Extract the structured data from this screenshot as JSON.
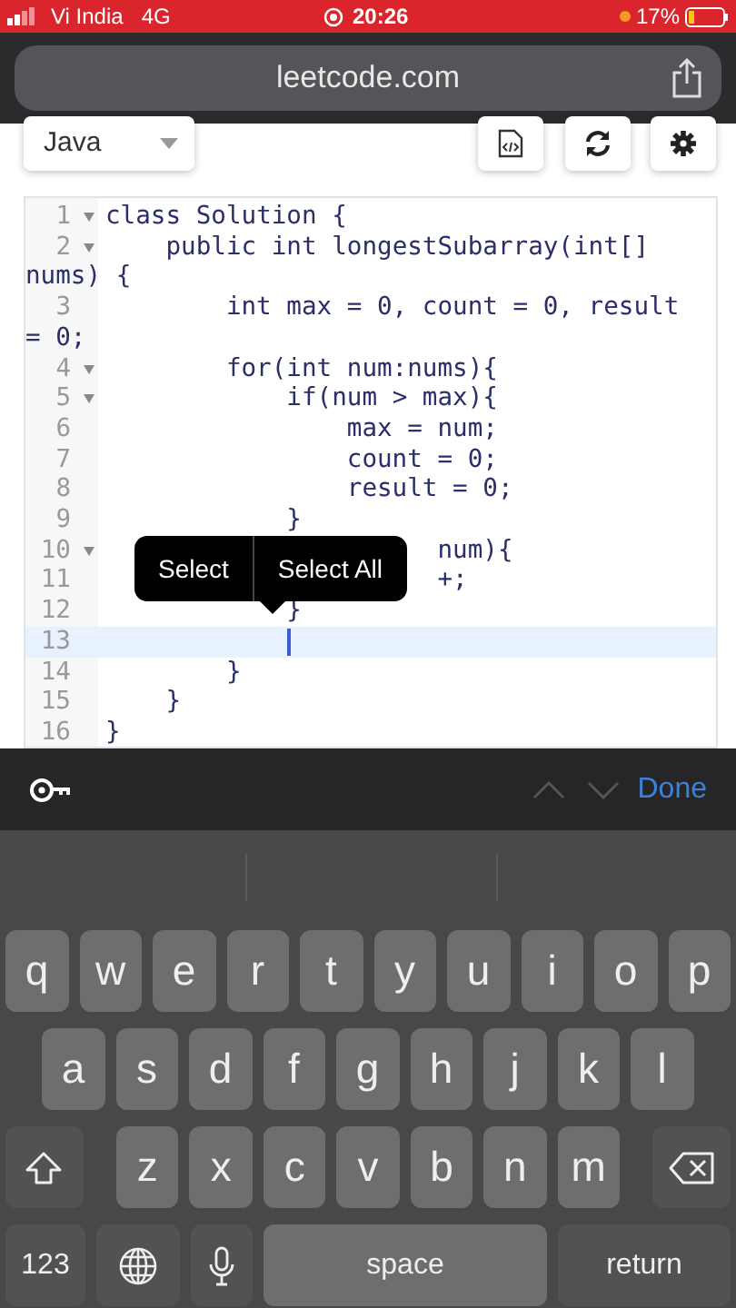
{
  "status_bar": {
    "carrier": "Vi India",
    "network": "4G",
    "time": "20:26",
    "battery": "17%"
  },
  "address_bar": {
    "url": "leetcode.com"
  },
  "toolbar": {
    "language": "Java"
  },
  "editor": {
    "lines": [
      {
        "number": "1",
        "rows": [
          "class Solution {"
        ],
        "foldable": true,
        "active": false
      },
      {
        "number": "2",
        "rows": [
          "    public int longestSubarray(int[]",
          "nums) {"
        ],
        "foldable": true,
        "active": false
      },
      {
        "number": "3",
        "rows": [
          "        int max = 0, count = 0, result",
          "= 0;"
        ],
        "foldable": false,
        "active": false
      },
      {
        "number": "4",
        "rows": [
          "        for(int num:nums){"
        ],
        "foldable": true,
        "active": false
      },
      {
        "number": "5",
        "rows": [
          "            if(num > max){"
        ],
        "foldable": true,
        "active": false
      },
      {
        "number": "6",
        "rows": [
          "                max = num;"
        ],
        "foldable": false,
        "active": false
      },
      {
        "number": "7",
        "rows": [
          "                count = 0;"
        ],
        "foldable": false,
        "active": false
      },
      {
        "number": "8",
        "rows": [
          "                result = 0;"
        ],
        "foldable": false,
        "active": false
      },
      {
        "number": "9",
        "rows": [
          "            }"
        ],
        "foldable": false,
        "active": false
      },
      {
        "number": "10",
        "rows": [
          "                      num){"
        ],
        "foldable": true,
        "active": false
      },
      {
        "number": "11",
        "rows": [
          "                      +;"
        ],
        "foldable": false,
        "active": false
      },
      {
        "number": "12",
        "rows": [
          "            }"
        ],
        "foldable": false,
        "active": false
      },
      {
        "number": "13",
        "rows": [
          "            "
        ],
        "foldable": false,
        "active": true
      },
      {
        "number": "14",
        "rows": [
          "        }"
        ],
        "foldable": false,
        "active": false
      },
      {
        "number": "15",
        "rows": [
          "    }"
        ],
        "foldable": false,
        "active": false
      },
      {
        "number": "16",
        "rows": [
          "}"
        ],
        "foldable": false,
        "active": false
      }
    ],
    "context_menu": {
      "items": [
        "Select",
        "Select All"
      ]
    }
  },
  "keyboard": {
    "accessory": {
      "done": "Done"
    },
    "rows": [
      [
        {
          "kind": "letter",
          "label": "q"
        },
        {
          "kind": "letter",
          "label": "w"
        },
        {
          "kind": "letter",
          "label": "e"
        },
        {
          "kind": "letter",
          "label": "r"
        },
        {
          "kind": "letter",
          "label": "t"
        },
        {
          "kind": "letter",
          "label": "y"
        },
        {
          "kind": "letter",
          "label": "u"
        },
        {
          "kind": "letter",
          "label": "i"
        },
        {
          "kind": "letter",
          "label": "o"
        },
        {
          "kind": "letter",
          "label": "p"
        }
      ],
      [
        {
          "kind": "letter",
          "label": "a"
        },
        {
          "kind": "letter",
          "label": "s"
        },
        {
          "kind": "letter",
          "label": "d"
        },
        {
          "kind": "letter",
          "label": "f"
        },
        {
          "kind": "letter",
          "label": "g"
        },
        {
          "kind": "letter",
          "label": "h"
        },
        {
          "kind": "letter",
          "label": "j"
        },
        {
          "kind": "letter",
          "label": "k"
        },
        {
          "kind": "letter",
          "label": "l"
        }
      ],
      [
        {
          "kind": "shift"
        },
        {
          "kind": "letter",
          "label": "z"
        },
        {
          "kind": "letter",
          "label": "x"
        },
        {
          "kind": "letter",
          "label": "c"
        },
        {
          "kind": "letter",
          "label": "v"
        },
        {
          "kind": "letter",
          "label": "b"
        },
        {
          "kind": "letter",
          "label": "n"
        },
        {
          "kind": "letter",
          "label": "m"
        },
        {
          "kind": "delete"
        }
      ]
    ],
    "bottom_row": [
      {
        "kind": "numbers",
        "label": "123"
      },
      {
        "kind": "globe"
      },
      {
        "kind": "mic"
      },
      {
        "kind": "space",
        "label": "space"
      },
      {
        "kind": "return",
        "label": "return"
      }
    ]
  }
}
